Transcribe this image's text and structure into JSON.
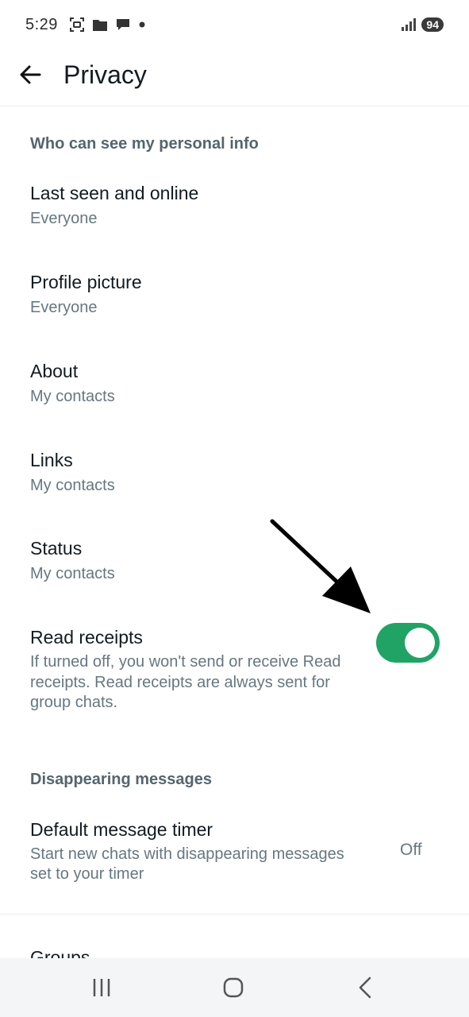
{
  "status_bar": {
    "time": "5:29",
    "battery": "94",
    "icons": [
      "screenshot-icon",
      "folder-icon",
      "chat-bubble-icon",
      "dot-icon",
      "signal-icon"
    ]
  },
  "app_bar": {
    "title": "Privacy",
    "back_icon": "arrow-left-icon"
  },
  "sections": {
    "personal_info_header": "Who can see my personal info",
    "disappearing_header": "Disappearing messages"
  },
  "items": {
    "last_seen": {
      "title": "Last seen and online",
      "value": "Everyone"
    },
    "profile_picture": {
      "title": "Profile picture",
      "value": "Everyone"
    },
    "about": {
      "title": "About",
      "value": "My contacts"
    },
    "links": {
      "title": "Links",
      "value": "My contacts"
    },
    "status": {
      "title": "Status",
      "value": "My contacts"
    },
    "read_receipts": {
      "title": "Read receipts",
      "description_line1": "If turned off, you won't send or receive Read",
      "description_line2": "receipts. Read receipts are always sent for",
      "description_line3": "group chats.",
      "enabled": true
    },
    "default_timer": {
      "title": "Default message timer",
      "description_line1": "Start new chats with disappearing messages",
      "description_line2": "set to your timer",
      "value": "Off"
    },
    "groups": {
      "title": "Groups"
    }
  },
  "colors": {
    "toggle_on": "#21a366",
    "annotation_arrow": "#000000"
  },
  "nav_bar": {
    "icons": [
      "recent-apps-icon",
      "home-icon",
      "back-icon"
    ]
  }
}
